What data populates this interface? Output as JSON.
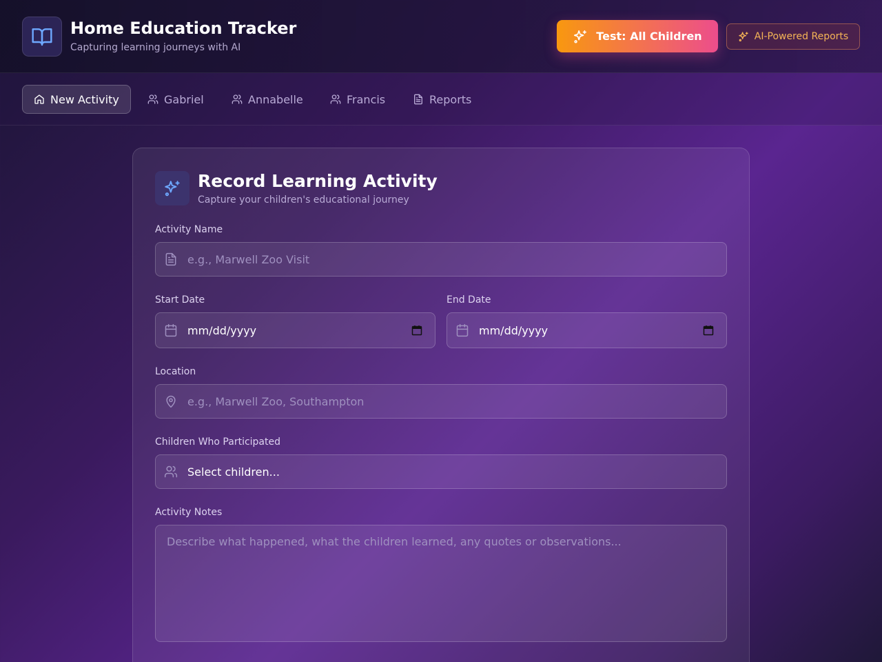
{
  "header": {
    "title": "Home Education Tracker",
    "subtitle": "Capturing learning journeys with AI",
    "test_button": "Test: All Children",
    "ai_reports_button": "AI-Powered Reports"
  },
  "nav": {
    "items": [
      {
        "label": "New Activity",
        "icon": "home-icon",
        "active": true
      },
      {
        "label": "Gabriel",
        "icon": "users-icon",
        "active": false
      },
      {
        "label": "Annabelle",
        "icon": "users-icon",
        "active": false
      },
      {
        "label": "Francis",
        "icon": "users-icon",
        "active": false
      },
      {
        "label": "Reports",
        "icon": "file-text-icon",
        "active": false
      }
    ]
  },
  "form": {
    "title": "Record Learning Activity",
    "subtitle": "Capture your children's educational journey",
    "activity_name": {
      "label": "Activity Name",
      "placeholder": "e.g., Marwell Zoo Visit",
      "value": ""
    },
    "start_date": {
      "label": "Start Date",
      "value": "mm/dd/yyyy"
    },
    "end_date": {
      "label": "End Date",
      "value": "mm/dd/yyyy"
    },
    "location": {
      "label": "Location",
      "placeholder": "e.g., Marwell Zoo, Southampton",
      "value": ""
    },
    "children": {
      "label": "Children Who Participated",
      "value": "Select children..."
    },
    "notes": {
      "label": "Activity Notes",
      "placeholder": "Describe what happened, what the children learned, any quotes or observations..."
    }
  },
  "colors": {
    "accent_orange": "#f8980f",
    "accent_pink": "#ec4d8c",
    "ai_reports_text": "#f5b456",
    "icon_blue": "#6ea8ff"
  }
}
